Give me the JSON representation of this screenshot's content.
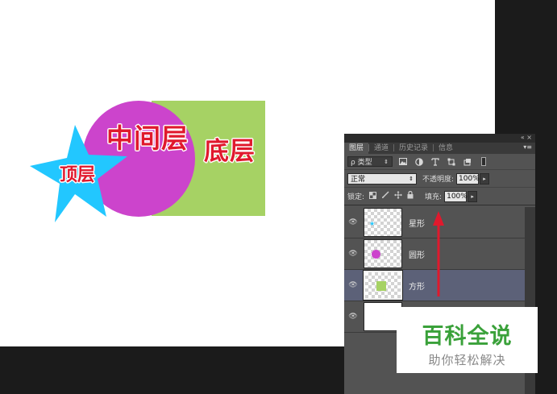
{
  "canvas": {
    "labels": {
      "bottom": "底层",
      "middle": "中间层",
      "top": "顶层"
    },
    "colors": {
      "square": "#a6d264",
      "circle": "#cc44cc",
      "star": "#22c7ff",
      "label": "#e0192d"
    }
  },
  "panel": {
    "controls": "«  ×",
    "menu": "▾≡",
    "tabs": [
      "图层",
      "通道",
      "历史记录",
      "信息"
    ],
    "filter": {
      "label": "ρ 类型",
      "chevron": "⇕"
    },
    "filter_icons": [
      "image-filter-icon",
      "adjustment-filter-icon",
      "type-filter-icon",
      "shape-filter-icon",
      "smart-object-filter-icon"
    ],
    "blend_mode": "正常",
    "opacity_label": "不透明度:",
    "opacity_value": "100%",
    "lock_label": "锁定:",
    "fill_label": "填充:",
    "fill_value": "100%",
    "layers": [
      {
        "name": "星形",
        "visible": true,
        "selected": false
      },
      {
        "name": "圆形",
        "visible": true,
        "selected": false
      },
      {
        "name": "方形",
        "visible": true,
        "selected": true
      },
      {
        "name": "",
        "visible": true,
        "selected": false
      }
    ]
  },
  "watermark": {
    "title": "百科全说",
    "subtitle": "助你轻松解决"
  },
  "arrow": {
    "color": "#e0192d"
  }
}
